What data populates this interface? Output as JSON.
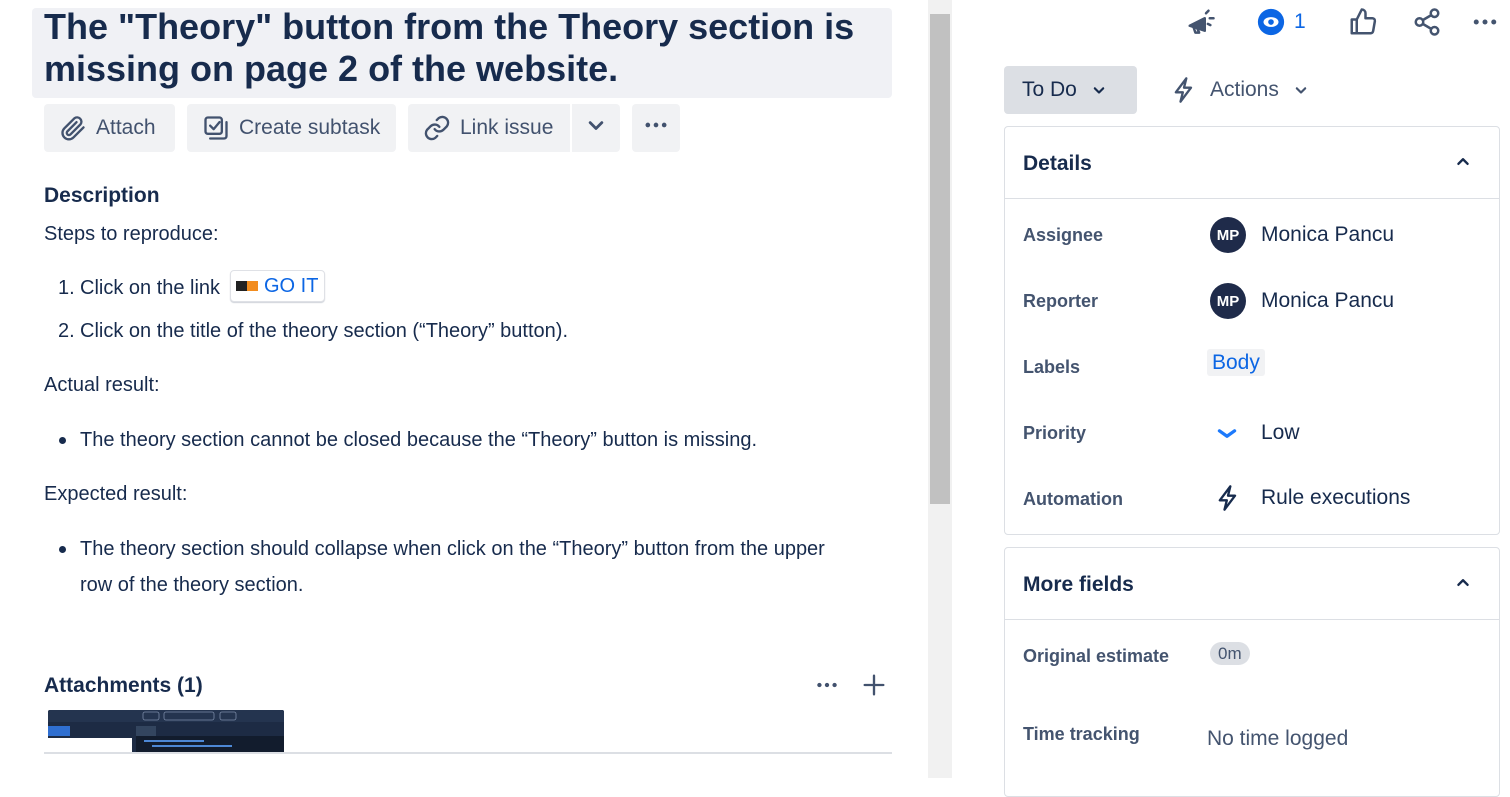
{
  "issue": {
    "title": "The \"Theory\" button from the Theory section is missing on page 2 of the website."
  },
  "toolbar": {
    "attach_label": "Attach",
    "create_subtask_label": "Create subtask",
    "link_issue_label": "Link issue"
  },
  "description": {
    "heading": "Description",
    "steps_intro": "Steps to reproduce:",
    "steps": [
      {
        "num": "1.",
        "text": "Click on the link",
        "link_text": "GO IT"
      },
      {
        "num": "2.",
        "text": "Click on the title of the theory section (“Theory” button)."
      }
    ],
    "actual_heading": "Actual result:",
    "actual_items": [
      "The theory section cannot be closed because the “Theory” button is missing."
    ],
    "expected_heading": "Expected result:",
    "expected_items": [
      "The theory section should collapse when click on the “Theory” button from the upper",
      "row of the theory section."
    ]
  },
  "attachments": {
    "heading": "Attachments (1)"
  },
  "header_actions": {
    "watch_count": "1"
  },
  "status": {
    "current": "To Do",
    "actions_label": "Actions"
  },
  "details": {
    "title": "Details",
    "fields": [
      {
        "label": "Assignee",
        "value": "Monica Pancu",
        "initials": "MP"
      },
      {
        "label": "Reporter",
        "value": "Monica Pancu",
        "initials": "MP"
      },
      {
        "label": "Labels",
        "value": "Body"
      },
      {
        "label": "Priority",
        "value": "Low"
      },
      {
        "label": "Automation",
        "value": "Rule executions"
      }
    ]
  },
  "more_fields": {
    "title": "More fields",
    "fields": [
      {
        "label": "Original estimate",
        "value": "0m"
      },
      {
        "label": "Time tracking",
        "value": "No time logged"
      }
    ]
  },
  "colors": {
    "link": "#0c66e4",
    "text": "#172b4d",
    "subtle": "#44546f",
    "watch": "#0c66e4",
    "priority_low": "#1d7afc"
  },
  "icons": {
    "attach": "paperclip-icon",
    "subtask": "subtask-icon",
    "link": "link-icon",
    "more": "more-horizontal-icon",
    "announce": "megaphone-icon",
    "watch": "eye-icon",
    "vote": "thumbs-up-icon",
    "share": "share-icon",
    "actions": "lightning-icon",
    "collapse": "chevron-up-icon",
    "add": "plus-icon"
  }
}
